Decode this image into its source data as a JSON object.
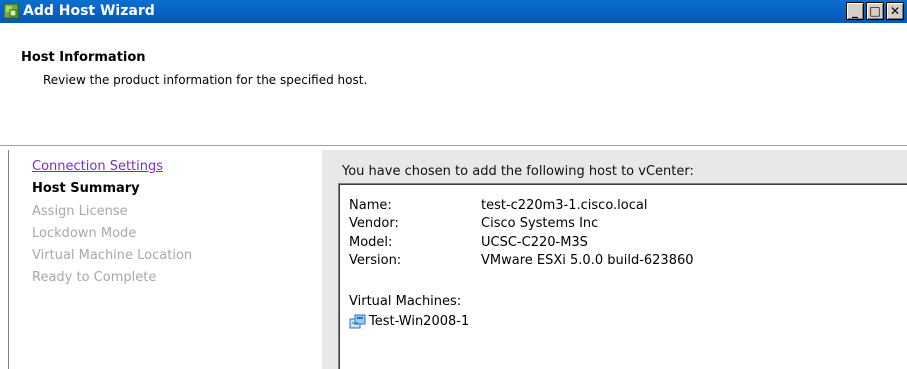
{
  "window": {
    "title": "Add Host Wizard",
    "min_glyph": "_",
    "max_glyph": "□",
    "close_glyph": "✕"
  },
  "header": {
    "title": "Host Information",
    "subtitle": "Review the product information for the specified host."
  },
  "steps": [
    {
      "label": "Connection Settings",
      "state": "link"
    },
    {
      "label": "Host Summary",
      "state": "current"
    },
    {
      "label": "Assign License",
      "state": "disabled"
    },
    {
      "label": "Lockdown Mode",
      "state": "disabled"
    },
    {
      "label": "Virtual Machine Location",
      "state": "disabled"
    },
    {
      "label": "Ready to Complete",
      "state": "disabled"
    }
  ],
  "summary": {
    "intro": "You have chosen to add the following host to vCenter:",
    "rows": [
      {
        "key": "Name:",
        "value": "test-c220m3-1.cisco.local"
      },
      {
        "key": "Vendor:",
        "value": "Cisco Systems Inc"
      },
      {
        "key": "Model:",
        "value": "UCSC-C220-M3S"
      },
      {
        "key": "Version:",
        "value": "VMware ESXi 5.0.0 build-623860"
      }
    ],
    "vm_label": "Virtual Machines:",
    "vms": [
      "Test-Win2008-1"
    ]
  },
  "colors": {
    "titlebar": "#0458b8",
    "link": "#7b2fbf",
    "disabled": "#a8a8a8"
  }
}
